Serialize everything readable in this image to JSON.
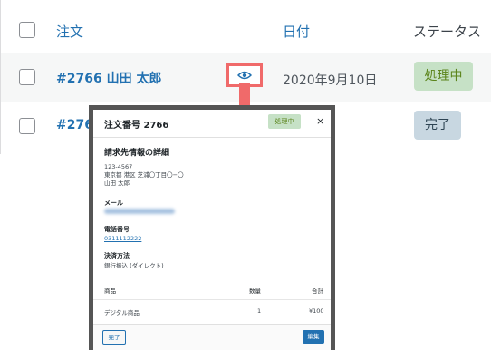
{
  "table": {
    "headers": {
      "order": "注文",
      "date": "日付",
      "status": "ステータス"
    },
    "rows": [
      {
        "order": "#2766 山田 太郎",
        "date": "2020年9月10日",
        "status": "処理中"
      },
      {
        "order": "#2765",
        "status": "完了"
      }
    ]
  },
  "modal": {
    "title": "注文番号 2766",
    "status": "処理中",
    "close": "×",
    "billing_heading": "請求先情報の詳細",
    "address": [
      "123-4567",
      "東京都 港区 芝浦〇丁目〇−〇",
      "山田 太郎"
    ],
    "email_label": "メール",
    "phone_label": "電話番号",
    "phone": "0311112222",
    "payment_label": "決済方法",
    "payment": "銀行振込 (ダイレクト)",
    "items_header": {
      "product": "商品",
      "qty": "数量",
      "total": "合計"
    },
    "items": [
      {
        "product": "デジタル商品",
        "qty": "1",
        "total": "¥100"
      }
    ],
    "done_button": "完了",
    "edit_button": "編集"
  },
  "colors": {
    "link": "#2271b1",
    "processing_bg": "#c6e1c6",
    "completed_bg": "#c8d7e1",
    "highlight": "#f06a6a"
  }
}
